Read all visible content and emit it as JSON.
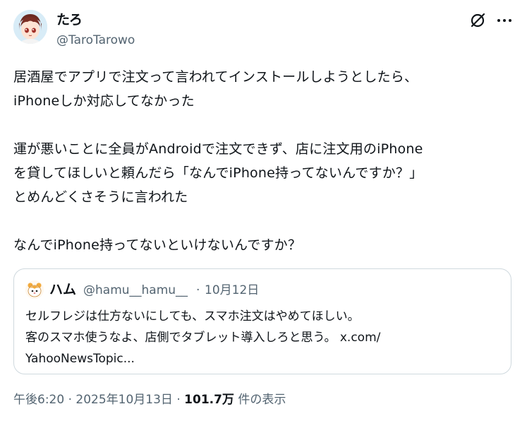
{
  "author": {
    "display_name": "たろ",
    "handle": "@TaroTarowo"
  },
  "header_icons": {
    "grok": "grok-icon",
    "more": "more-icon"
  },
  "tweet": {
    "text": "居酒屋でアプリで注文って言われてインストールしようとしたら、\niPhoneしか対応してなかった\n\n運が悪いことに全員がAndroidで注文できず、店に注文用のiPhone\nを貸してほしいと頼んだら「なんでiPhone持ってないんですか？」\nとめんどくさそうに言われた\n\nなんでiPhone持ってないといけないんですか？"
  },
  "quote": {
    "display_name": "ハム",
    "handle": "@hamu__hamu__",
    "separator": "·",
    "date": "10月12日",
    "text": "セルフレジは仕方ないにしても、スマホ注文はやめてほしい。\n客のスマホ使うなよ、店側でタブレット導入しろと思う。 ",
    "link_text": "x.com/\nYahooNewsTopic..."
  },
  "meta": {
    "time": "午後6:20",
    "sep1": " · ",
    "date": "2025年10月13日",
    "sep2": " · ",
    "views": "101.7万",
    "views_label": " 件の表示"
  },
  "colors": {
    "text": "#0f1419",
    "secondary": "#536471",
    "border": "#cfd9de"
  }
}
